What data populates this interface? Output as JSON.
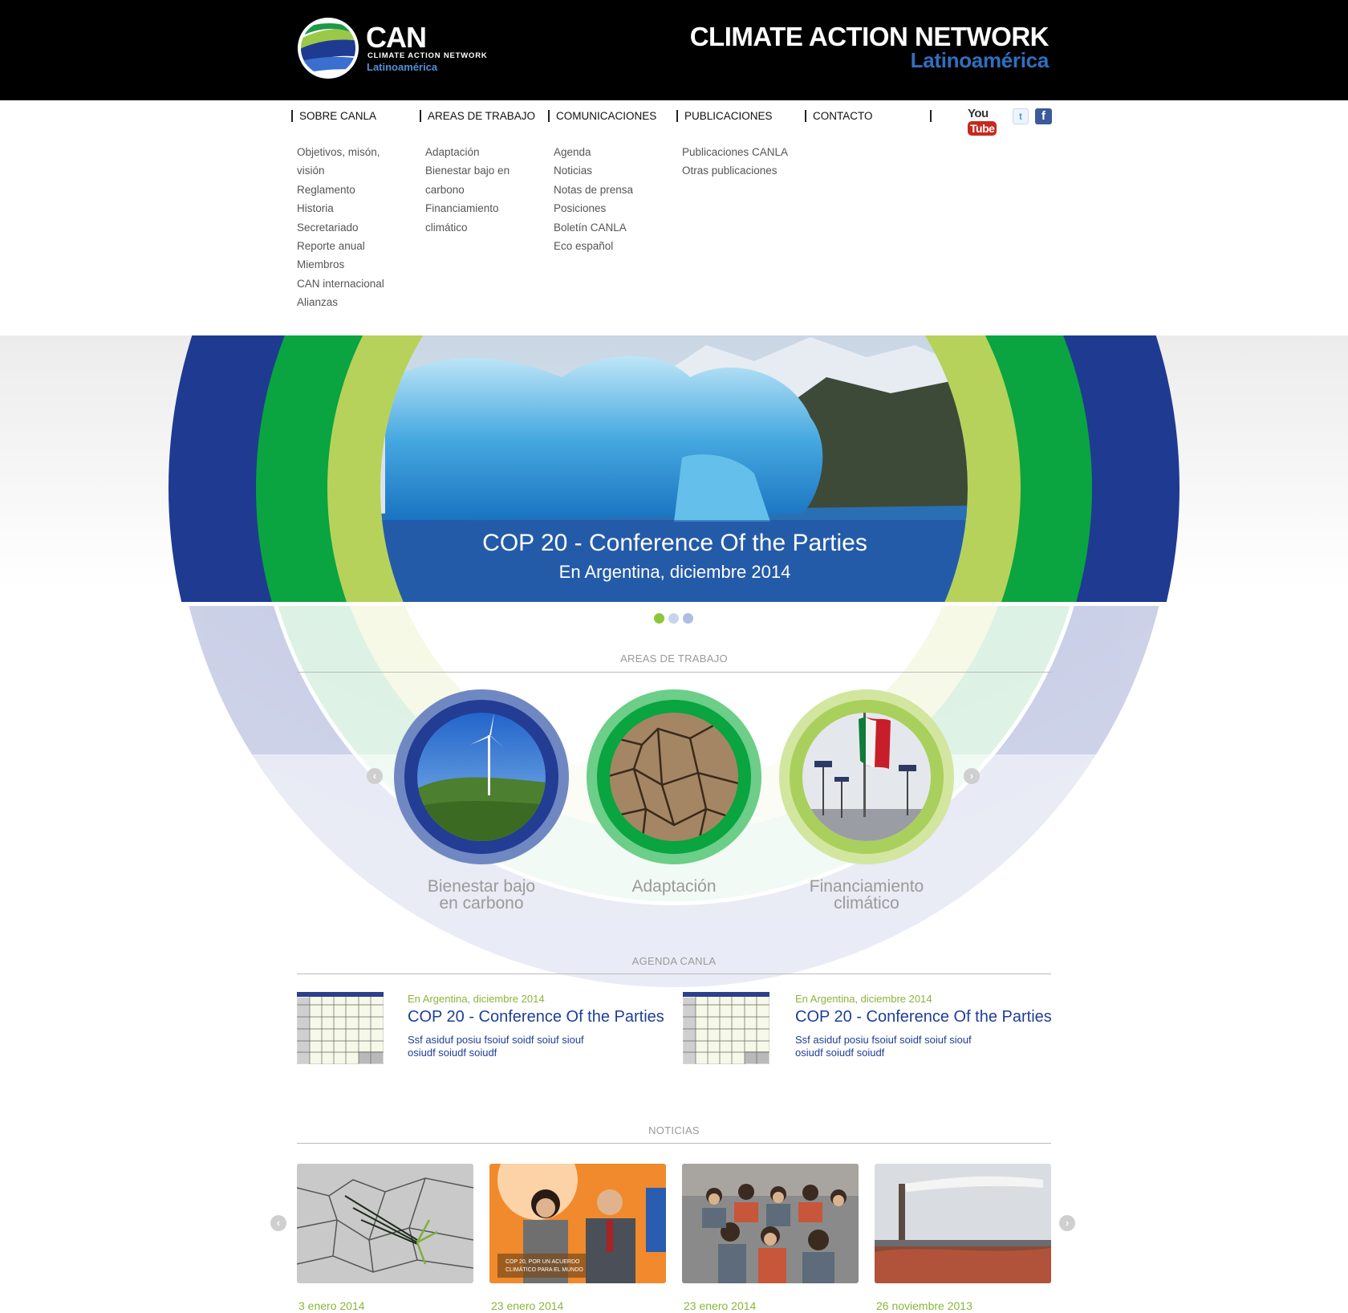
{
  "header": {
    "brand_short": "CAN",
    "brand_full": "CLIMATE ACTION NETWORK",
    "brand_region": "Latinoamérica",
    "title": "CLIMATE ACTION NETWORK",
    "title_region": "Latinoamérica"
  },
  "nav": {
    "items": [
      {
        "label": "SOBRE CANLA",
        "submenu": [
          "Objetivos, misón,",
          "visión",
          "Reglamento",
          "Historia",
          "Secretariado",
          "Reporte anual",
          "Miembros",
          "CAN internacional",
          "Alianzas"
        ]
      },
      {
        "label": "AREAS DE TRABAJO",
        "submenu": [
          "Adaptación",
          "Bienestar bajo en",
          "carbono",
          "Financiamiento",
          "climático"
        ]
      },
      {
        "label": "COMUNICACIONES",
        "submenu": [
          "Agenda",
          "Noticias",
          "Notas de prensa",
          "Posiciones",
          "Boletín CANLA",
          "Eco español"
        ]
      },
      {
        "label": "PUBLICACIONES",
        "submenu": [
          "Publicaciones CANLA",
          "Otras publicaciones"
        ]
      },
      {
        "label": "CONTACTO",
        "submenu": []
      }
    ],
    "social": {
      "youtube_you": "You",
      "youtube_tube": "Tube",
      "twitter": "t",
      "facebook": "f"
    }
  },
  "hero": {
    "slide_title": "COP 20 - Conference Of the Parties",
    "slide_subtitle": "En Argentina, diciembre 2014",
    "slide_count": 3,
    "active_slide": 1,
    "colors": {
      "blue": "#1f3a91",
      "green": "#0aa440",
      "lime": "#b6d25a"
    }
  },
  "areas": {
    "heading": "AREAS DE TRABAJO",
    "items": [
      {
        "label_line1": "Bienestar bajo",
        "label_line2": "en carbono",
        "ring_color": "#233c94"
      },
      {
        "label_line1": "Adaptación",
        "label_line2": "",
        "ring_color": "#0aa440"
      },
      {
        "label_line1": "Financiamiento",
        "label_line2": "climático",
        "ring_color": "#a9d05c"
      }
    ]
  },
  "agenda": {
    "heading": "AGENDA CANLA",
    "items": [
      {
        "date": "En Argentina, diciembre 2014",
        "title": "COP 20 - Conference Of the Parties",
        "desc_line1": "Ssf asiduf posiu fsoiuf soidf soiuf siouf",
        "desc_line2": "osiudf soiudf soiudf"
      },
      {
        "date": "En Argentina, diciembre 2014",
        "title": "COP 20 - Conference Of the Parties",
        "desc_line1": "Ssf asiduf posiu fsoiuf soidf soiuf siouf",
        "desc_line2": "osiudf soiudf soiudf"
      }
    ]
  },
  "news": {
    "heading": "NOTICIAS",
    "items": [
      {
        "date": "3 enero 2014",
        "image": "cracked-earth-plant"
      },
      {
        "date": "23 enero 2014",
        "image": "tv-interview",
        "caption_line1": "COP 20, POR UN ACUERDO",
        "caption_line2": "CLIMÁTICO PARA EL MUNDO"
      },
      {
        "date": "23 enero 2014",
        "image": "group-meeting"
      },
      {
        "date": "26 noviembre 2013",
        "image": "smokestack"
      }
    ]
  }
}
